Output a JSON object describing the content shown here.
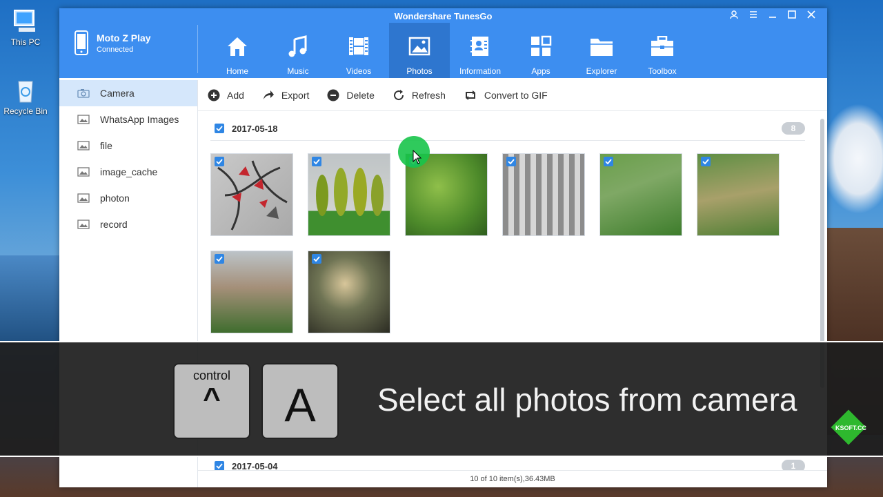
{
  "desktop": {
    "icons": [
      {
        "label": "This PC",
        "icon": "computer-icon"
      },
      {
        "label": "Recycle Bin",
        "icon": "recycle-bin-icon"
      }
    ]
  },
  "window": {
    "title": "Wondershare TunesGo",
    "controls": [
      "account-icon",
      "menu-icon",
      "minimize-icon",
      "maximize-icon",
      "close-icon"
    ]
  },
  "device": {
    "name": "Moto Z Play",
    "status": "Connected"
  },
  "nav": {
    "tabs": [
      {
        "label": "Home",
        "icon": "home-icon"
      },
      {
        "label": "Music",
        "icon": "music-icon"
      },
      {
        "label": "Videos",
        "icon": "video-icon"
      },
      {
        "label": "Photos",
        "icon": "photo-icon",
        "active": true
      },
      {
        "label": "Information",
        "icon": "contacts-icon"
      },
      {
        "label": "Apps",
        "icon": "apps-icon"
      },
      {
        "label": "Explorer",
        "icon": "folder-icon"
      },
      {
        "label": "Toolbox",
        "icon": "toolbox-icon"
      }
    ]
  },
  "sidebar": {
    "items": [
      {
        "label": "Camera",
        "active": true
      },
      {
        "label": "WhatsApp Images"
      },
      {
        "label": "file"
      },
      {
        "label": "image_cache"
      },
      {
        "label": "photon"
      },
      {
        "label": "record"
      }
    ]
  },
  "toolbar": {
    "add": "Add",
    "export": "Export",
    "delete": "Delete",
    "refresh": "Refresh",
    "convert": "Convert to GIF"
  },
  "groups": [
    {
      "date": "2017-05-18",
      "count": "8"
    },
    {
      "date": "2017-05-04",
      "count": "1"
    }
  ],
  "status": "10 of 10 item(s),36.43MB",
  "overlay": {
    "key1_label": "control",
    "key1_symbol": "^",
    "key2_label": "A",
    "caption": "Select all photos from camera"
  },
  "watermark": "KSOFT.CC",
  "colors": {
    "accent": "#3d8ef0",
    "active_tab": "#2e76cf",
    "checkbox": "#2f86e4"
  }
}
